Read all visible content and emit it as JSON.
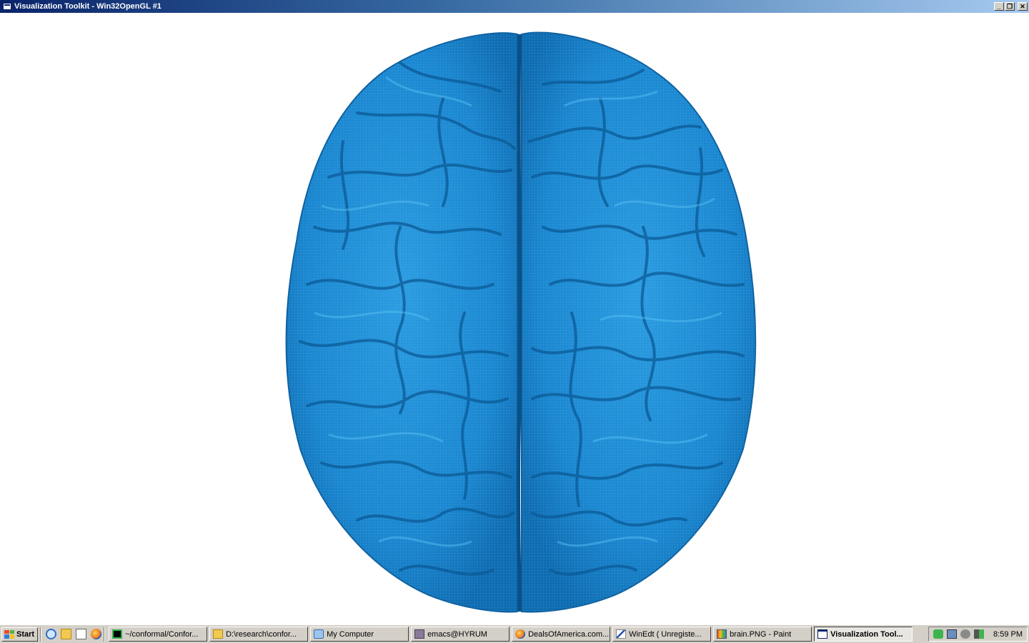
{
  "window": {
    "title": "Visualization Toolkit - Win32OpenGL #1",
    "controls": {
      "minimize": "_",
      "restore": "❐",
      "close": "✕"
    }
  },
  "viewport": {
    "content": "blue-brain-mesh",
    "background": "#ffffff",
    "mesh_color": "#1a8fd6"
  },
  "taskbar": {
    "start_label": "Start",
    "quick_launch": [
      "ie-icon",
      "folder-icon",
      "notepad-icon",
      "firefox-icon"
    ],
    "tasks": [
      {
        "label": "~/conformal/Confor...",
        "icon": "terminal-icon",
        "active": false
      },
      {
        "label": "D:\\research\\confor...",
        "icon": "folder-icon",
        "active": false
      },
      {
        "label": "My Computer",
        "icon": "computer-icon",
        "active": false
      },
      {
        "label": "emacs@HYRUM",
        "icon": "emacs-icon",
        "active": false
      },
      {
        "label": "DealsOfAmerica.com...",
        "icon": "firefox-icon",
        "active": false
      },
      {
        "label": "WinEdt  ( Unregiste...",
        "icon": "winedt-icon",
        "active": false
      },
      {
        "label": "brain.PNG - Paint",
        "icon": "paint-icon",
        "active": false
      },
      {
        "label": "Visualization Tool...",
        "icon": "window-icon",
        "active": true
      }
    ],
    "tray_icons": [
      "network-icon",
      "monitor-icon",
      "shield-icon",
      "speaker-icon"
    ],
    "clock": "8:59 PM"
  }
}
